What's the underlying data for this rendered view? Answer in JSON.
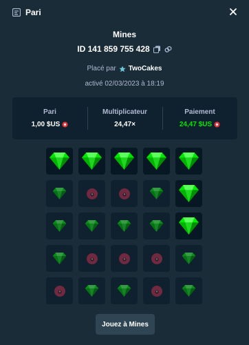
{
  "header": {
    "title": "Pari",
    "icon": "ticket-icon",
    "close_icon": "close-icon"
  },
  "game": {
    "name": "Mines",
    "bet_id": "ID 141 859 755 428",
    "placed_by_prefix": "Placé par",
    "username": "TwoCakes",
    "activated": "activé 02/03/2023 à 18:19"
  },
  "stats": {
    "bet_label": "Pari",
    "bet_value": "1,00 $US",
    "multiplier_label": "Multiplicateur",
    "multiplier_value": "24,47×",
    "payout_label": "Paiement",
    "payout_value": "24,47 $US"
  },
  "colors": {
    "background": "#1a2c38",
    "panel": "#0f212e",
    "gem": "#00e701",
    "payout_green": "#00e701",
    "mine": "#c0304e",
    "muted_text": "#b1bad3",
    "button": "#2f4553"
  },
  "board": {
    "rows": [
      [
        "gem-revealed",
        "gem-revealed",
        "gem-revealed",
        "gem-revealed",
        "gem-revealed"
      ],
      [
        "gem",
        "mine",
        "mine",
        "gem",
        "gem-revealed"
      ],
      [
        "gem",
        "gem",
        "gem",
        "gem",
        "gem-revealed"
      ],
      [
        "gem",
        "mine",
        "mine",
        "mine",
        "gem"
      ],
      [
        "mine",
        "gem",
        "gem",
        "mine",
        "gem"
      ]
    ]
  },
  "play_button": "Jouez à Mines"
}
